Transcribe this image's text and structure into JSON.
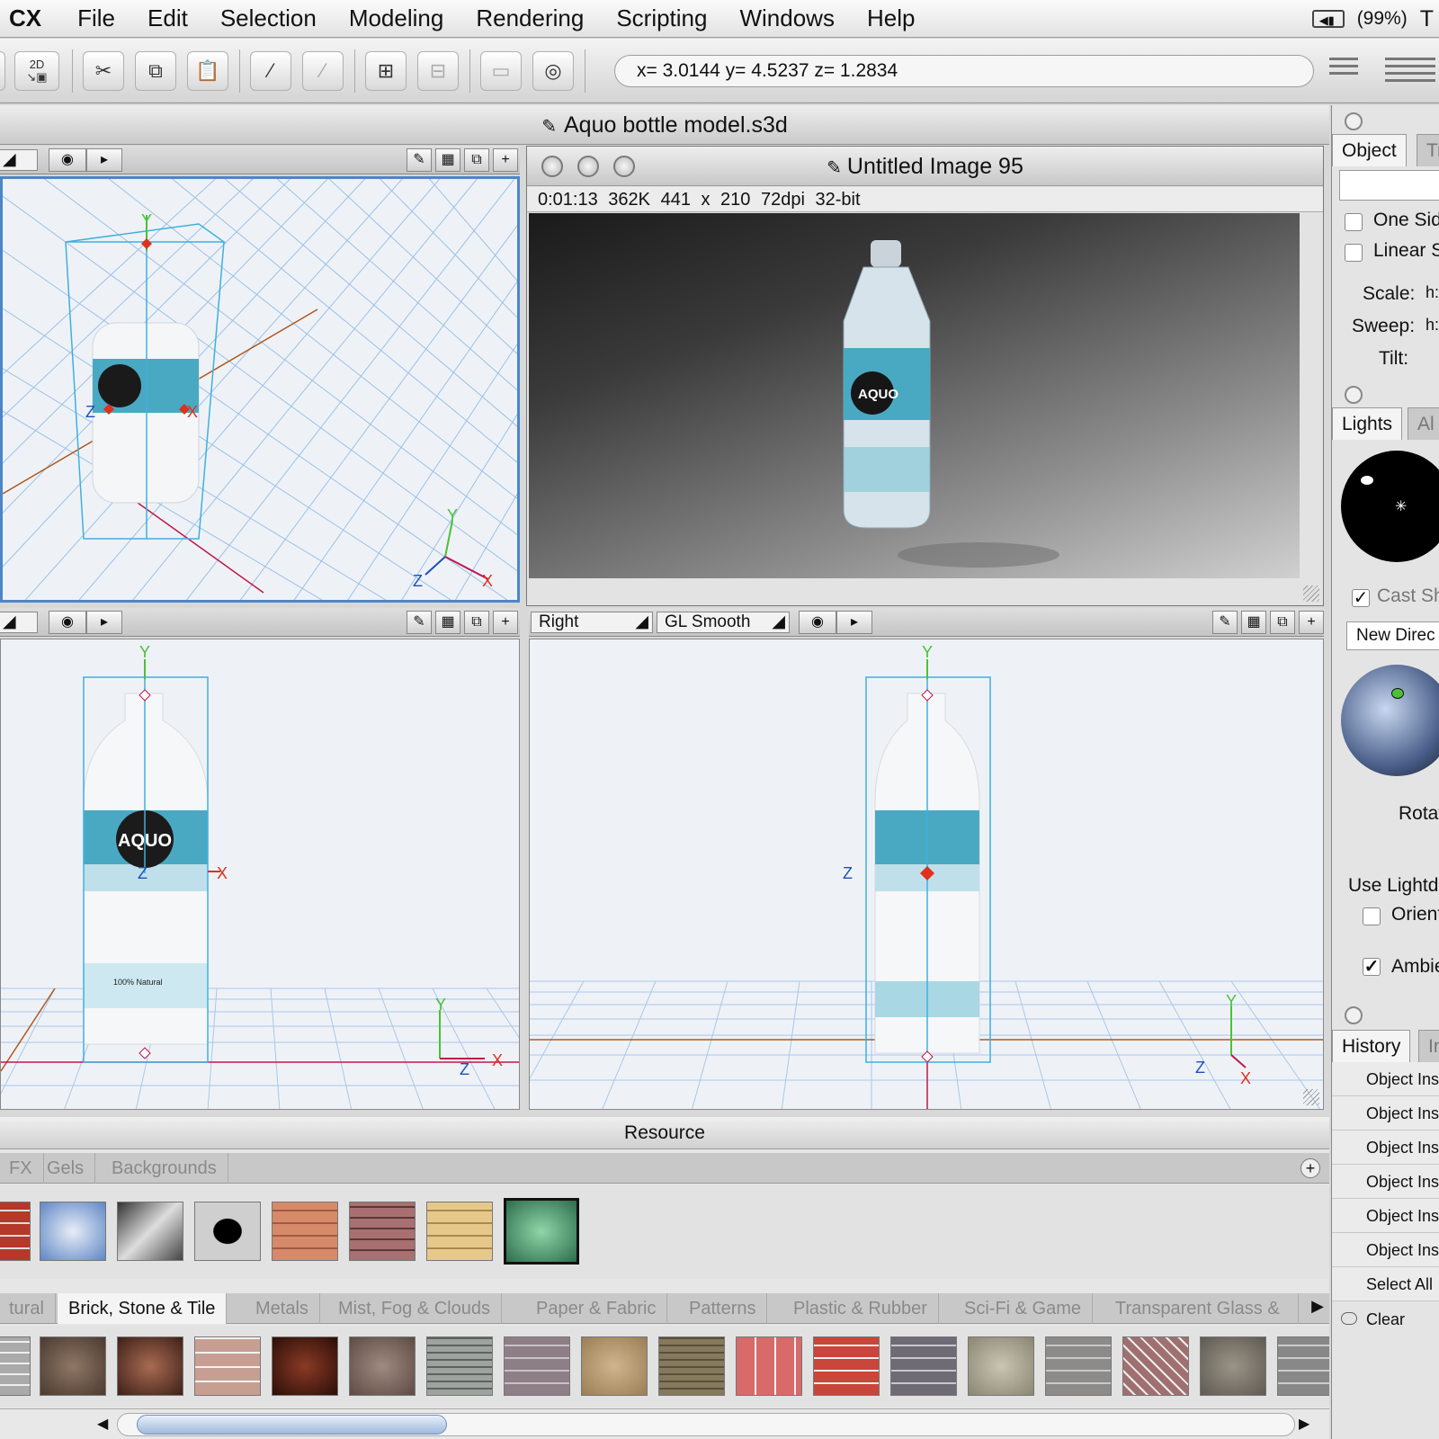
{
  "menubar": {
    "app": "CX",
    "items": [
      "File",
      "Edit",
      "Selection",
      "Modeling",
      "Rendering",
      "Scripting",
      "Windows",
      "Help"
    ],
    "battery": "(99%)",
    "extra": "T"
  },
  "toolbar": {
    "coords": "x= 3.0144  y= 4.5237  z= 1.2834",
    "mode_badge": "2D"
  },
  "document": {
    "title": "Aquo bottle model.s3d",
    "bottom_right_view": "Right",
    "bottom_right_render": "GL Smooth"
  },
  "render_window": {
    "title": "Untitled Image 95",
    "info": [
      "0:01:13",
      "362K",
      "441 x 210",
      "72dpi",
      "32-bit"
    ],
    "brand": "AQUO"
  },
  "viewports": {
    "axis_y": "Y",
    "axis_x": "X",
    "axis_z": "Z",
    "label_brand": "AQUO",
    "label_small": "100% Natural"
  },
  "right_panel": {
    "object_tabs": [
      "Object",
      "Tr"
    ],
    "one_sided": "One Side",
    "linear": "Linear S",
    "scale": "Scale:",
    "sweep": "Sweep:",
    "tilt": "Tilt:",
    "h_short": "h:",
    "lights_tabs": [
      "Lights",
      "Al"
    ],
    "cast_shadows": "Cast Sh",
    "new_direct": "New Direc",
    "rotate": "Rotat",
    "use_lightdome": "Use Lightdo",
    "orient": "Orient",
    "ambient": "Ambie",
    "history_tabs": [
      "History",
      "In"
    ],
    "history_items": [
      "Object Ins",
      "Object Ins",
      "Object Ins",
      "Object Ins",
      "Object Ins",
      "Object Ins",
      "Select All"
    ],
    "clear": "Clear"
  },
  "resource": {
    "title": "Resource",
    "top_tabs": [
      "FX",
      "Gels",
      "Backgrounds"
    ],
    "bottom_tabs": [
      "tural",
      "Brick, Stone & Tile",
      "Metals",
      "Mist, Fog & Clouds",
      "Paper & Fabric",
      "Patterns",
      "Plastic & Rubber",
      "Sci-Fi & Game",
      "Transparent Glass &"
    ],
    "active_bottom_tab": "Brick, Stone & Tile"
  },
  "colors": {
    "accent": "#4d86c8",
    "grid": "#9cc0e6",
    "bbox": "#3fb0e0",
    "axis_y": "#49c235",
    "axis_x": "#e0301e",
    "axis_z": "#1d4fb8",
    "label_teal": "#4aa9c2"
  }
}
